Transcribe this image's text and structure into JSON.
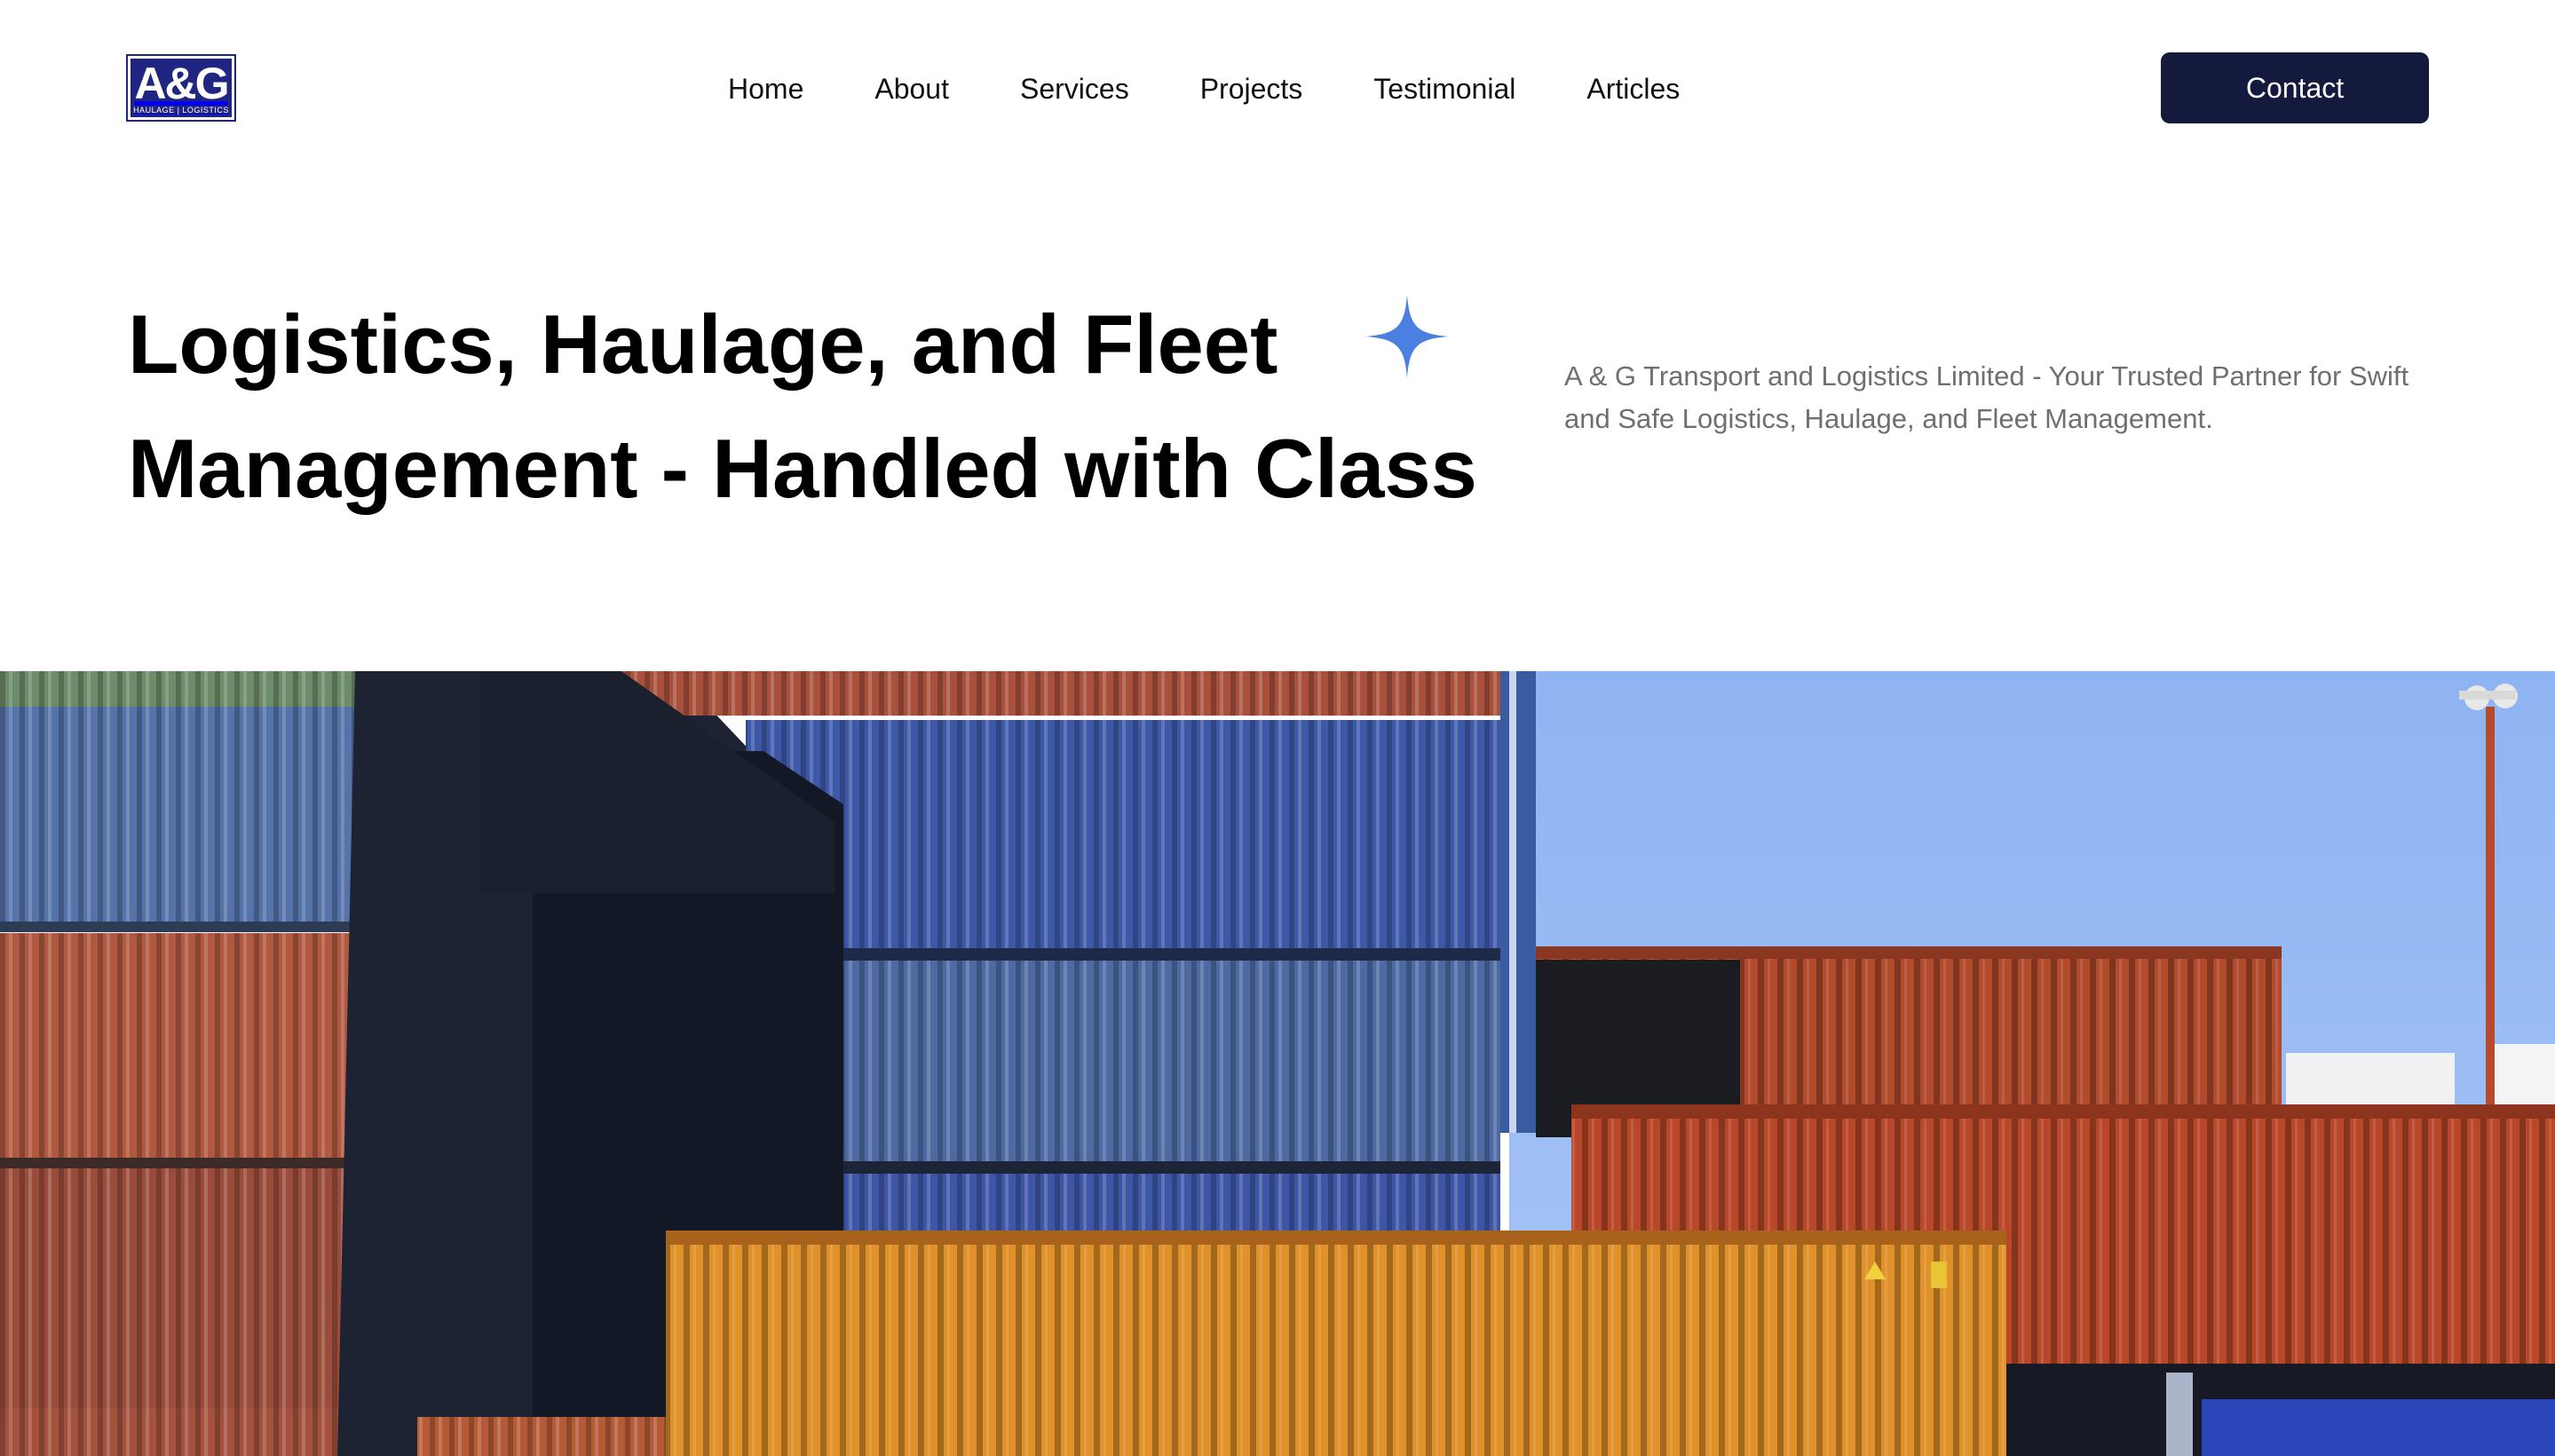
{
  "brand": {
    "logo_text": "A&G",
    "logo_subtext": "HAULAGE | LOGISTICS",
    "logo_color": "#1f2580"
  },
  "nav": {
    "items": [
      {
        "label": "Home"
      },
      {
        "label": "About"
      },
      {
        "label": "Services"
      },
      {
        "label": "Projects"
      },
      {
        "label": "Testimonial"
      },
      {
        "label": "Articles"
      }
    ]
  },
  "header": {
    "contact_label": "Contact",
    "contact_color": "#141a3d"
  },
  "hero": {
    "title_line1": "Logistics, Haulage, and Fleet",
    "title_line2": "Management - Handled with Class",
    "subtitle": "A & G Transport and Logistics Limited - Your Trusted Partner for Swift and Safe Logistics, Haulage, and Fleet Management.",
    "sparkle_icon": "four-point-star-icon",
    "accent_color": "#4b7fe0",
    "image_description_icon": "shipping-containers-photo"
  }
}
